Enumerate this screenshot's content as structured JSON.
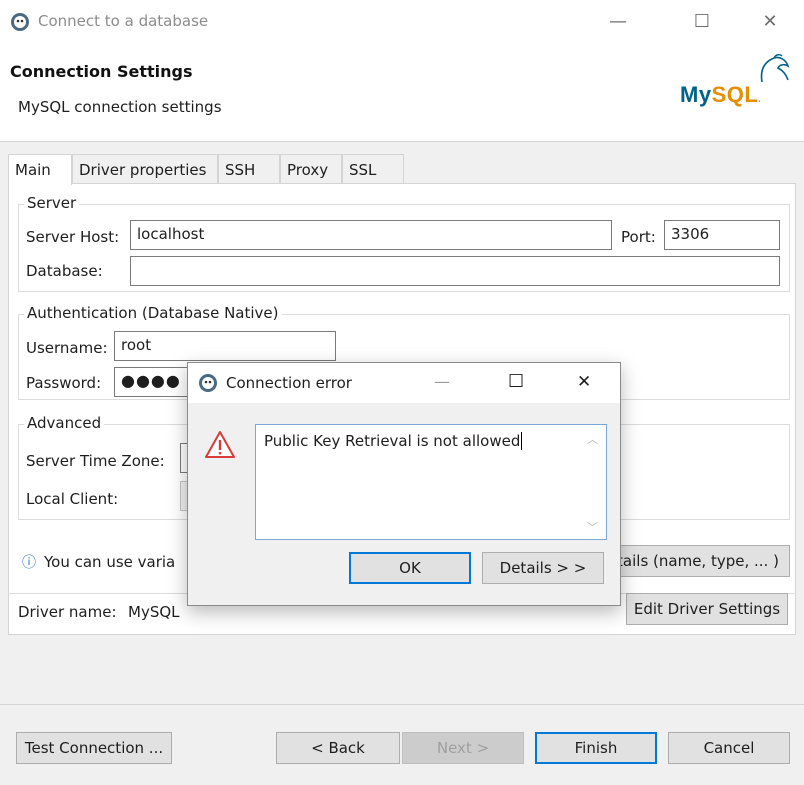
{
  "window": {
    "title": "Connect to a database",
    "minimize": "—",
    "maximize": "☐",
    "close": "✕"
  },
  "header": {
    "title": "Connection Settings",
    "subtitle": "MySQL connection settings",
    "logo_text": "MySQL"
  },
  "tabs": [
    {
      "label": "Main"
    },
    {
      "label": "Driver properties"
    },
    {
      "label": "SSH"
    },
    {
      "label": "Proxy"
    },
    {
      "label": "SSL"
    }
  ],
  "server": {
    "legend": "Server",
    "host_label": "Server Host:",
    "host_value": "localhost",
    "port_label": "Port:",
    "port_value": "3306",
    "database_label": "Database:",
    "database_value": ""
  },
  "auth": {
    "legend": "Authentication (Database Native)",
    "username_label": "Username:",
    "username_value": "root",
    "password_label": "Password:",
    "password_mask": "●●●●"
  },
  "advanced": {
    "legend": "Advanced",
    "timezone_label": "Server Time Zone:",
    "local_client_label": "Local Client:"
  },
  "info": {
    "icon": "ⓘ",
    "text": "You can use varia",
    "details_button": "tails (name, type, ... )"
  },
  "driver": {
    "label": "Driver name:",
    "value": "MySQL",
    "edit_button": "Edit Driver Settings"
  },
  "footer": {
    "test_connection": "Test Connection ...",
    "back": "< Back",
    "next": "Next >",
    "finish": "Finish",
    "cancel": "Cancel"
  },
  "dialog": {
    "title": "Connection error",
    "message": "Public Key Retrieval is not allowed",
    "ok": "OK",
    "details": "Details > >",
    "minimize": "—",
    "maximize": "☐",
    "close": "✕"
  },
  "colors": {
    "accent": "#0078d7",
    "warning": "#d83b3b",
    "mysql_blue": "#00618a",
    "mysql_orange": "#e48e00"
  }
}
